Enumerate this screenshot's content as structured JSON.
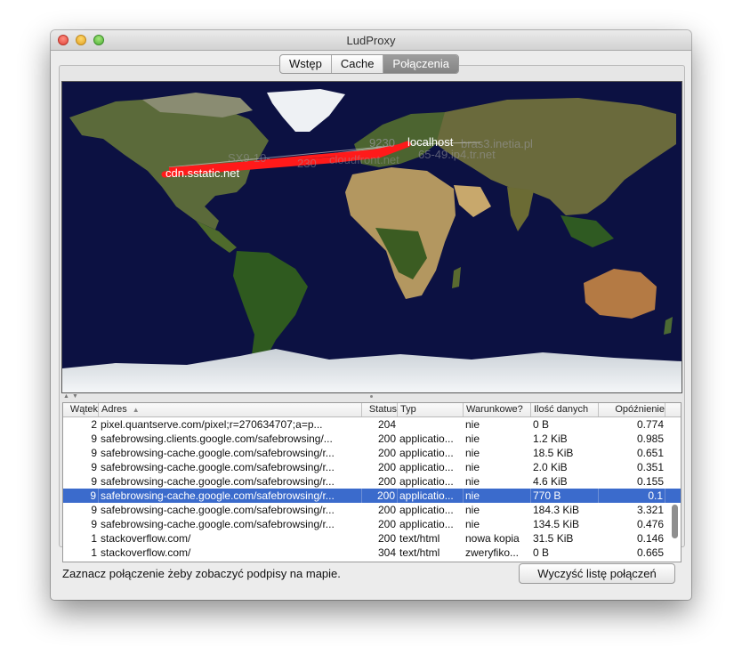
{
  "window": {
    "title": "LudProxy"
  },
  "tabs": [
    {
      "label": "Wstęp",
      "active": false
    },
    {
      "label": "Cache",
      "active": false
    },
    {
      "label": "Połączenia",
      "active": true
    }
  ],
  "map": {
    "labels": {
      "localhost": "localhost",
      "cdn": "cdn.sstatic.net",
      "ghost1": "9230",
      "ghost2": "bras3.inetia.pl",
      "ghost3": "65-49.ip4.tr.net",
      "ghost4": "SX9-10-",
      "ghost5": "230",
      "ghost6": "cloudfront.net"
    },
    "colors": {
      "ocean": "#0c1142",
      "route": "#ff1a1a",
      "label": "#ffffff"
    }
  },
  "table": {
    "columns": [
      "Wątek",
      "Adres",
      "Status",
      "Typ",
      "Warunkowe?",
      "Ilość danych",
      "Opóźnienie"
    ],
    "sorted_column": "Adres",
    "rows": [
      {
        "thread": "2",
        "address": "pixel.quantserve.com/pixel;r=270634707;a=p...",
        "status": "204",
        "type": "",
        "conditional": "nie",
        "size": "0 B",
        "delay": "0.774",
        "selected": false
      },
      {
        "thread": "9",
        "address": "safebrowsing.clients.google.com/safebrowsing/...",
        "status": "200",
        "type": "applicatio...",
        "conditional": "nie",
        "size": "1.2 KiB",
        "delay": "0.985",
        "selected": false
      },
      {
        "thread": "9",
        "address": "safebrowsing-cache.google.com/safebrowsing/r...",
        "status": "200",
        "type": "applicatio...",
        "conditional": "nie",
        "size": "18.5 KiB",
        "delay": "0.651",
        "selected": false
      },
      {
        "thread": "9",
        "address": "safebrowsing-cache.google.com/safebrowsing/r...",
        "status": "200",
        "type": "applicatio...",
        "conditional": "nie",
        "size": "2.0 KiB",
        "delay": "0.351",
        "selected": false
      },
      {
        "thread": "9",
        "address": "safebrowsing-cache.google.com/safebrowsing/r...",
        "status": "200",
        "type": "applicatio...",
        "conditional": "nie",
        "size": "4.6 KiB",
        "delay": "0.155",
        "selected": false
      },
      {
        "thread": "9",
        "address": "safebrowsing-cache.google.com/safebrowsing/r...",
        "status": "200",
        "type": "applicatio...",
        "conditional": "nie",
        "size": "770 B",
        "delay": "0.1",
        "selected": true
      },
      {
        "thread": "9",
        "address": "safebrowsing-cache.google.com/safebrowsing/r...",
        "status": "200",
        "type": "applicatio...",
        "conditional": "nie",
        "size": "184.3 KiB",
        "delay": "3.321",
        "selected": false
      },
      {
        "thread": "9",
        "address": "safebrowsing-cache.google.com/safebrowsing/r...",
        "status": "200",
        "type": "applicatio...",
        "conditional": "nie",
        "size": "134.5 KiB",
        "delay": "0.476",
        "selected": false
      },
      {
        "thread": "1",
        "address": "stackoverflow.com/",
        "status": "200",
        "type": "text/html",
        "conditional": "nowa kopia",
        "size": "31.5 KiB",
        "delay": "0.146",
        "selected": false
      },
      {
        "thread": "1",
        "address": "stackoverflow.com/",
        "status": "304",
        "type": "text/html",
        "conditional": "zweryfiko...",
        "size": "0 B",
        "delay": "0.665",
        "selected": false
      }
    ]
  },
  "footer": {
    "hint": "Zaznacz połączenie żeby zobaczyć podpisy na mapie.",
    "clear_label": "Wyczyść listę połączeń"
  }
}
